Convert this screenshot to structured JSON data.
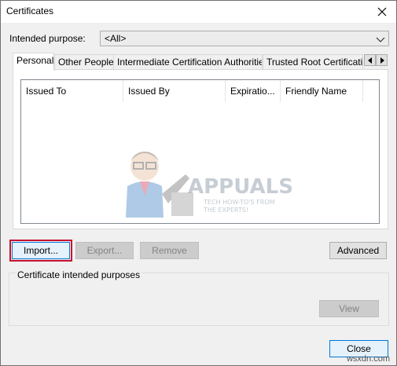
{
  "window": {
    "title": "Certificates"
  },
  "purpose": {
    "label": "Intended purpose:",
    "value": "<All>"
  },
  "tabs": [
    {
      "label": "Personal",
      "active": true
    },
    {
      "label": "Other People"
    },
    {
      "label": "Intermediate Certification Authorities"
    },
    {
      "label": "Trusted Root Certification Authorities"
    }
  ],
  "columns": [
    "Issued To",
    "Issued By",
    "Expiratio...",
    "Friendly Name"
  ],
  "watermark": {
    "brand": "APPUALS",
    "tagline_1": "TECH HOW-TO'S FROM",
    "tagline_2": "THE EXPERTS!"
  },
  "buttons": {
    "import": "Import...",
    "export": "Export...",
    "remove": "Remove",
    "advanced": "Advanced",
    "view": "View",
    "close": "Close"
  },
  "group": {
    "caption": "Certificate intended purposes"
  },
  "footer": {
    "site": "wsxdn.com"
  },
  "colors": {
    "accent": "#0078d7",
    "highlight": "#c8102e"
  }
}
